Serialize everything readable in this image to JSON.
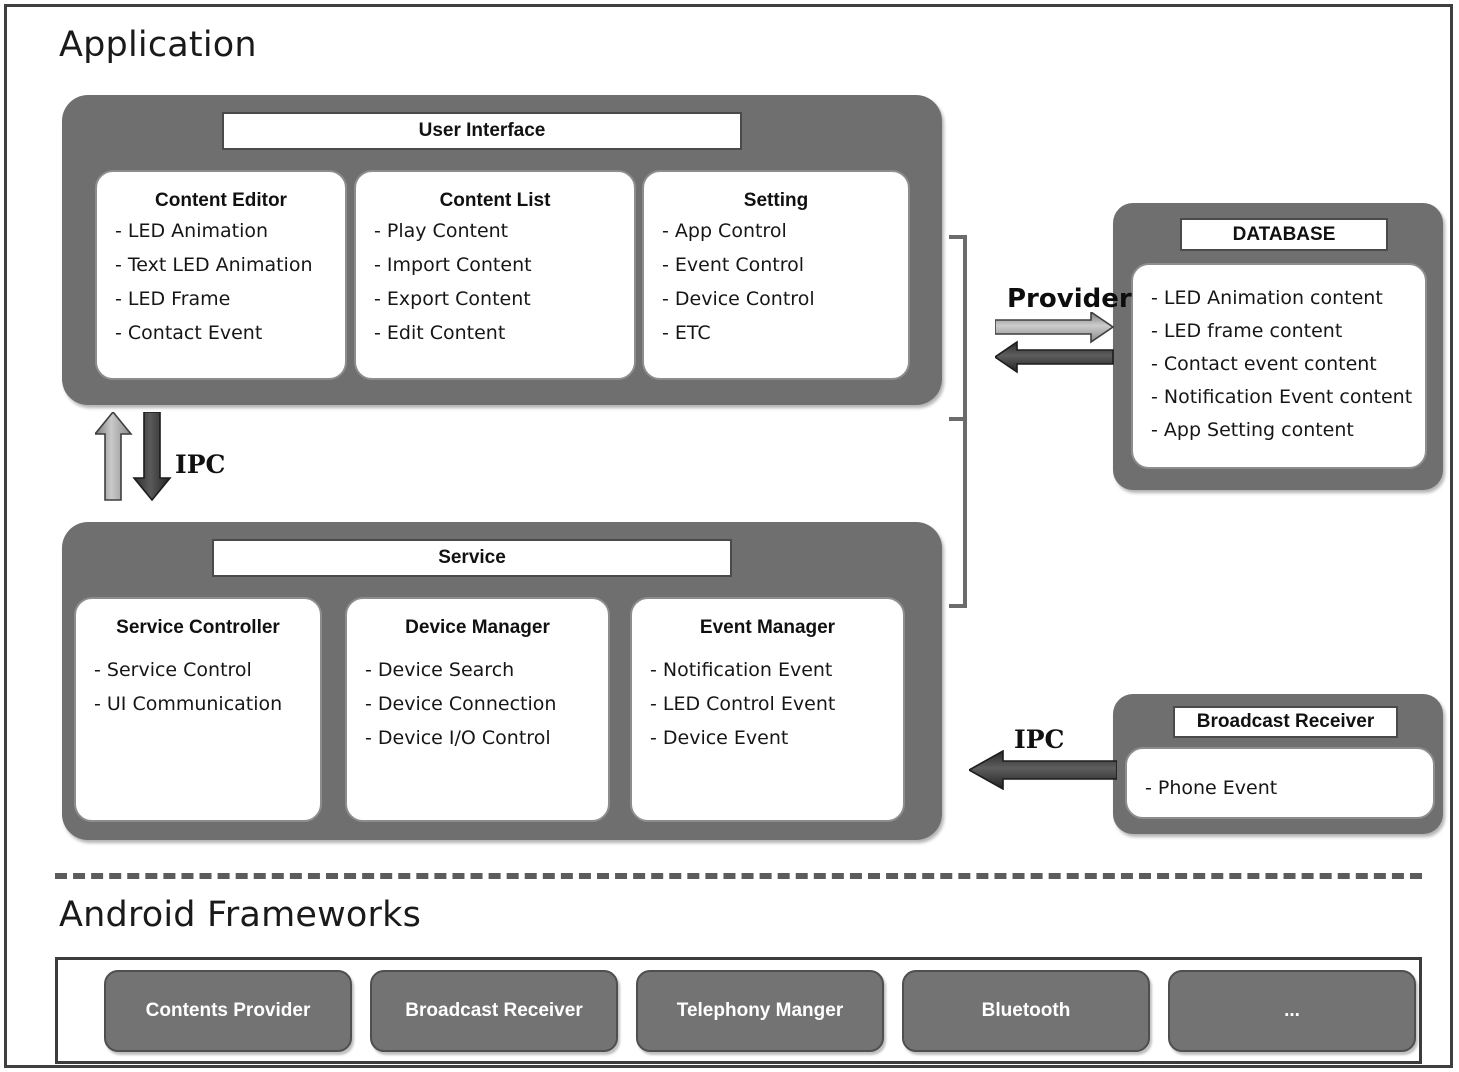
{
  "sections": {
    "application_title": "Application",
    "android_title": "Android Frameworks"
  },
  "ui_panel": {
    "header": "User Interface",
    "cards": [
      {
        "title": "Content Editor",
        "items": [
          "- LED Animation",
          "- Text LED Animation",
          "- LED Frame",
          "- Contact Event"
        ]
      },
      {
        "title": "Content List",
        "items": [
          "- Play Content",
          "- Import Content",
          "- Export Content",
          "- Edit Content"
        ]
      },
      {
        "title": "Setting",
        "items": [
          "- App Control",
          "- Event Control",
          "- Device Control",
          "- ETC"
        ]
      }
    ]
  },
  "service_panel": {
    "header": "Service",
    "cards": [
      {
        "title": "Service Controller",
        "items": [
          "- Service Control",
          "- UI Communication"
        ]
      },
      {
        "title": "Device Manager",
        "items": [
          "- Device Search",
          "- Device Connection",
          "- Device I/O Control"
        ]
      },
      {
        "title": "Event Manager",
        "items": [
          "- Notification Event",
          "- LED Control Event",
          "- Device Event"
        ]
      }
    ]
  },
  "database_panel": {
    "header": "DATABASE",
    "items": [
      "- LED Animation content",
      "- LED frame content",
      "- Contact event content",
      "- Notification Event content",
      "- App Setting content"
    ]
  },
  "broadcast_panel": {
    "header": "Broadcast Receiver",
    "items": [
      "- Phone Event"
    ]
  },
  "connectors": {
    "ipc_left_label": "IPC",
    "ipc_right_label": "IPC",
    "provider_label": "Provider"
  },
  "frameworks": {
    "chips": [
      "Contents Provider",
      "Broadcast Receiver",
      "Telephony Manger",
      "Bluetooth",
      "..."
    ]
  },
  "colors": {
    "panel_gray": "#6f6f6f",
    "chip_gray": "#737373",
    "frame_dark": "#3c3c3c",
    "arrow_dark": "#4a4a4a",
    "arrow_light": "#a9a9a9"
  }
}
